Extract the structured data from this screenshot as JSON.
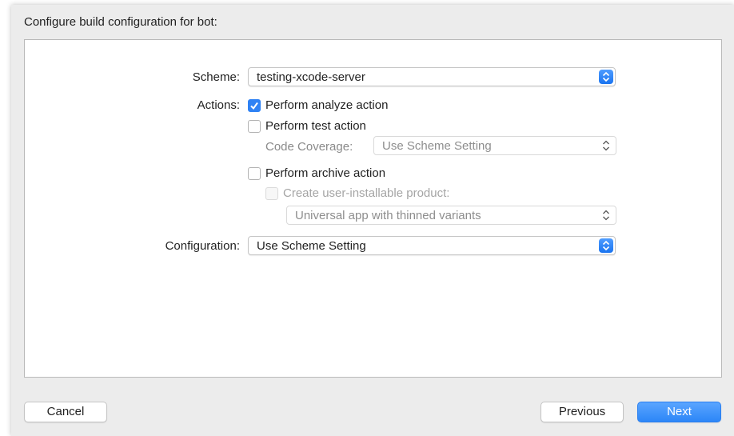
{
  "dialog": {
    "heading": "Configure build configuration for bot:"
  },
  "form": {
    "scheme_label": "Scheme:",
    "scheme_value": "testing-xcode-server",
    "actions_label": "Actions:",
    "analyze_label": "Perform analyze action",
    "analyze_checked": true,
    "test_label": "Perform test action",
    "test_checked": false,
    "coverage_label": "Code Coverage:",
    "coverage_value": "Use Scheme Setting",
    "archive_label": "Perform archive action",
    "archive_checked": false,
    "installable_label": "Create user-installable product:",
    "installable_checked": false,
    "installable_value": "Universal app with thinned variants",
    "configuration_label": "Configuration:",
    "configuration_value": "Use Scheme Setting"
  },
  "buttons": {
    "cancel": "Cancel",
    "previous": "Previous",
    "next": "Next"
  },
  "colors": {
    "accent": "#2f82f4",
    "sheet_bg": "#ececec"
  }
}
